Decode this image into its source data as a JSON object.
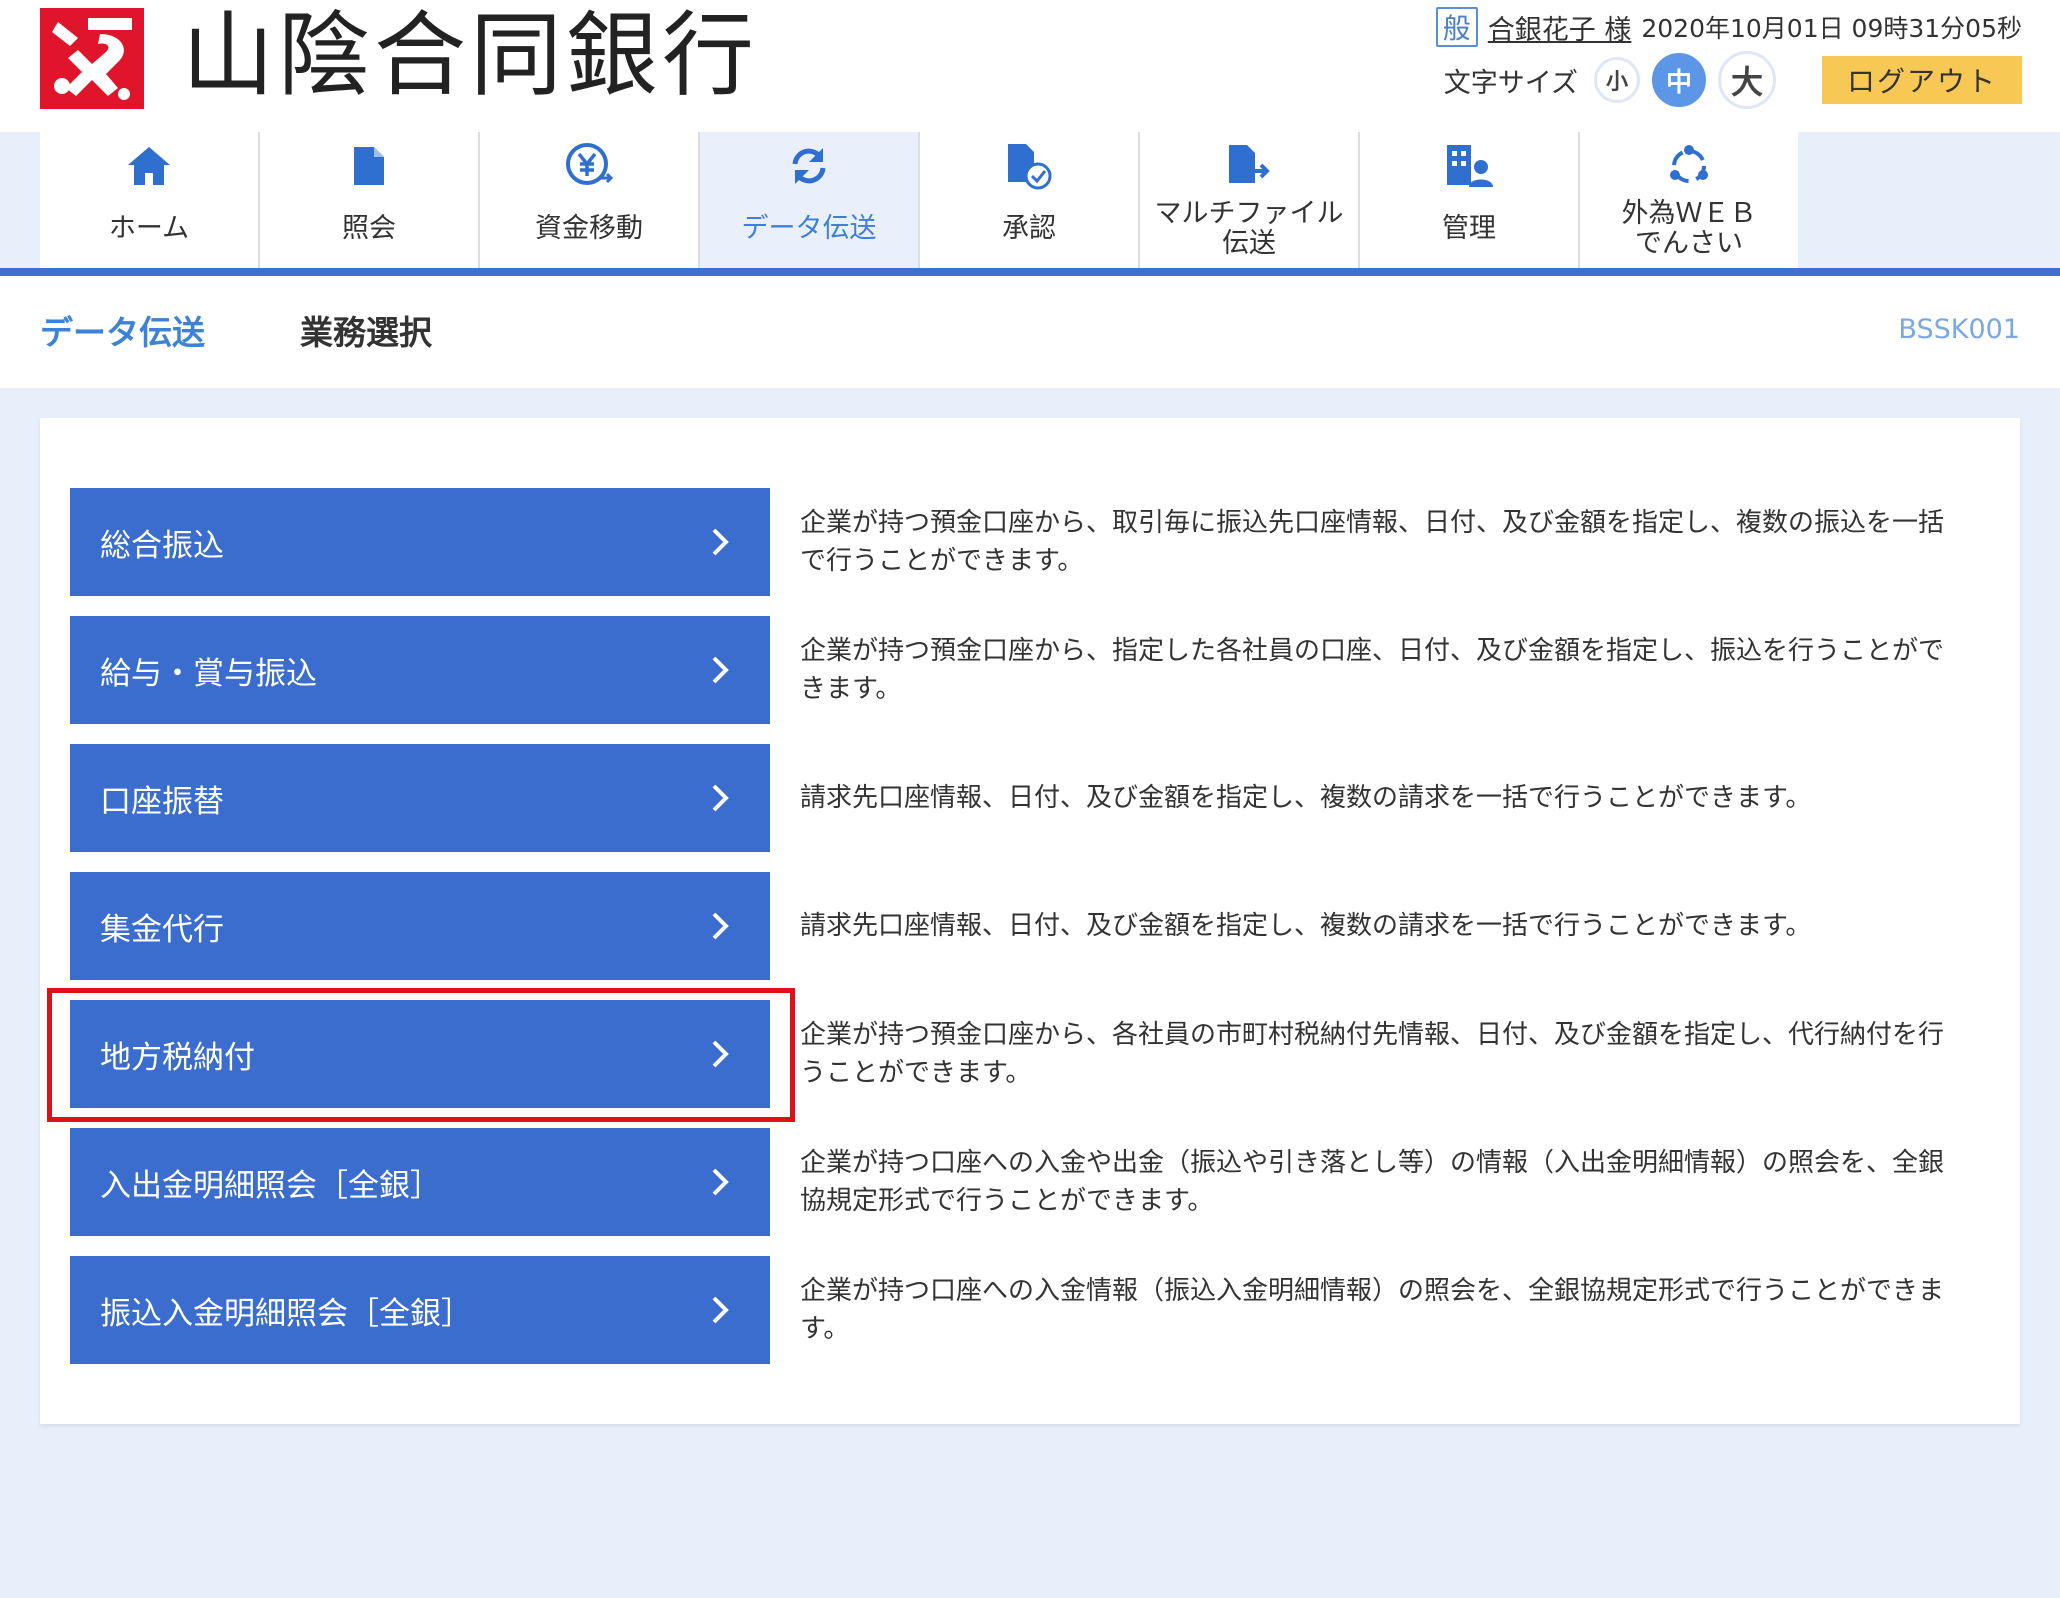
{
  "header": {
    "bank_name": "山陰合同銀行",
    "user_badge": "般",
    "user_name": "合銀花子 様",
    "datetime": "2020年10月01日 09時31分05秒",
    "font_size_label": "文字サイズ",
    "font_small": "小",
    "font_mid": "中",
    "font_large": "大",
    "logout_label": "ログアウト"
  },
  "nav": {
    "items": [
      {
        "label": "ホーム",
        "icon": "home-icon"
      },
      {
        "label": "照会",
        "icon": "document-icon"
      },
      {
        "label": "資金移動",
        "icon": "yen-transfer-icon"
      },
      {
        "label": "データ伝送",
        "icon": "refresh-icon"
      },
      {
        "label": "承認",
        "icon": "approve-document-icon"
      },
      {
        "label": "マルチファイル\n伝送",
        "icon": "file-transfer-icon"
      },
      {
        "label": "管理",
        "icon": "building-user-icon"
      },
      {
        "label": "外為ＷＥＢ\nでんさい",
        "icon": "network-icon"
      }
    ],
    "active_index": 3
  },
  "title": {
    "main": "データ伝送",
    "sub": "業務選択",
    "screen_id": "BSSK001"
  },
  "menu": [
    {
      "label": "総合振込",
      "desc": "企業が持つ預金口座から、取引毎に振込先口座情報、日付、及び金額を指定し、複数の振込を一括で行うことができます。"
    },
    {
      "label": "給与・賞与振込",
      "desc": "企業が持つ預金口座から、指定した各社員の口座、日付、及び金額を指定し、振込を行うことができます。"
    },
    {
      "label": "口座振替",
      "desc": "請求先口座情報、日付、及び金額を指定し、複数の請求を一括で行うことができます。"
    },
    {
      "label": "集金代行",
      "desc": "請求先口座情報、日付、及び金額を指定し、複数の請求を一括で行うことができます。"
    },
    {
      "label": "地方税納付",
      "desc": "企業が持つ預金口座から、各社員の市町村税納付先情報、日付、及び金額を指定し、代行納付を行うことができます。"
    },
    {
      "label": "入出金明細照会［全銀］",
      "desc": "企業が持つ口座への入金や出金（振込や引き落とし等）の情報（入出金明細情報）の照会を、全銀協規定形式で行うことができます。"
    },
    {
      "label": "振込入金明細照会［全銀］",
      "desc": "企業が持つ口座への入金情報（振込入金明細情報）の照会を、全銀協規定形式で行うことができます。"
    }
  ],
  "colors": {
    "accent": "#3a6dcd",
    "highlight": "#e0101a",
    "logout": "#f8c854",
    "logo": "#e0142a"
  }
}
